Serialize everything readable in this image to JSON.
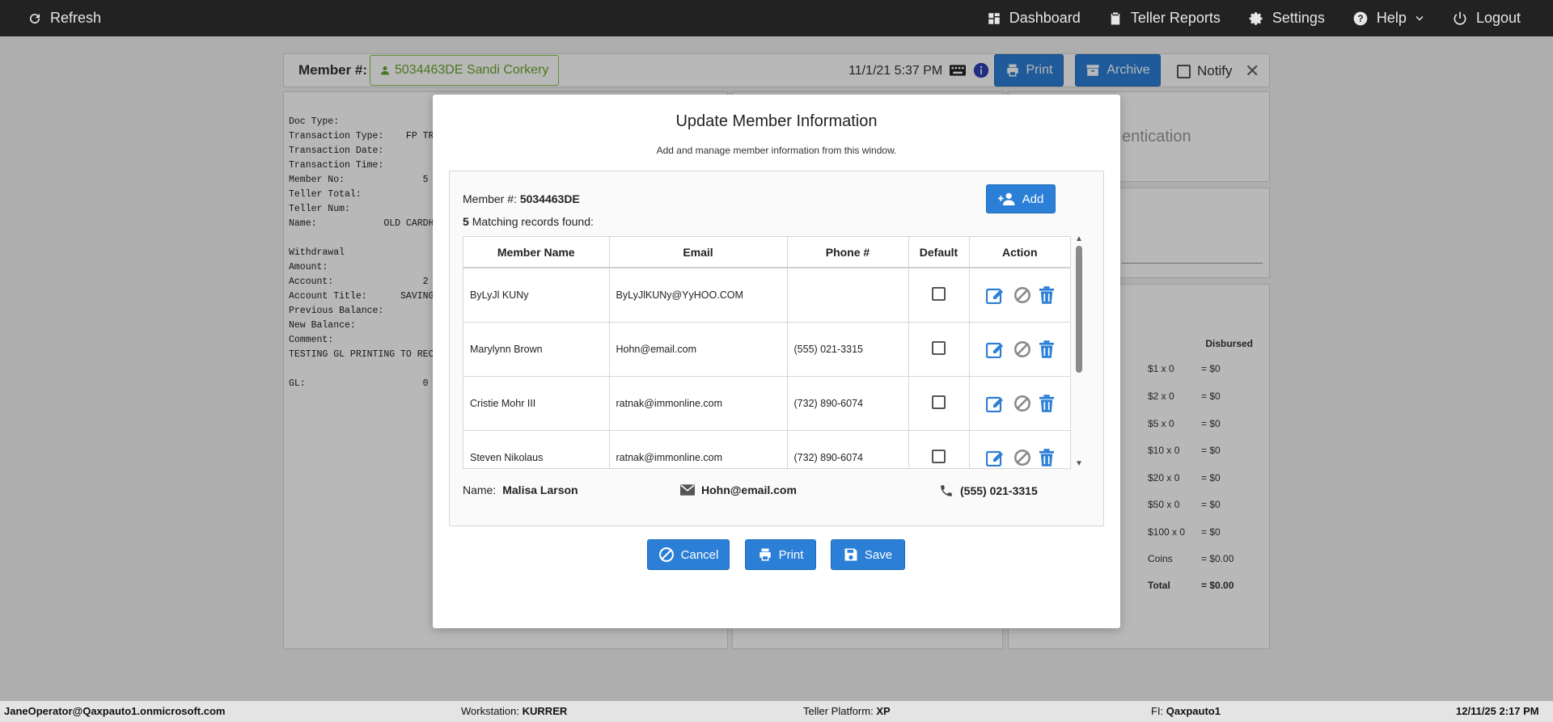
{
  "topbar": {
    "refresh": "Refresh",
    "dashboard": "Dashboard",
    "teller_reports": "Teller Reports",
    "settings": "Settings",
    "help": "Help",
    "logout": "Logout"
  },
  "member_bar": {
    "label": "Member #:",
    "member_badge": "5034463DE Sandi Corkery",
    "datetime": "11/1/21 5:37 PM",
    "print": "Print",
    "archive": "Archive",
    "notify": "Notify"
  },
  "receipt": {
    "lines": "Doc Type:\nTransaction Type:    FP TRA\nTransaction Date:\nTransaction Time:\nMember No:              5\nTeller Total:\nTeller Num:\nName:            OLD CARDH\n\nWithdrawal\nAmount:\nAccount:                2\nAccount Title:      SAVINGS\nPrevious Balance:\nNew Balance:\nComment:\nTESTING GL PRINTING TO RECE\n\nGL:                     0"
  },
  "auth_panel": {
    "text": "entication"
  },
  "cash": {
    "header": "Disbursed",
    "rows": [
      {
        "label": "$1 x 0",
        "value": "= $0"
      },
      {
        "label": "$2 x 0",
        "value": "= $0"
      },
      {
        "label": "$5 x 0",
        "value": "= $0"
      },
      {
        "label": "$10 x 0",
        "value": "= $0"
      },
      {
        "label": "$20 x 0",
        "value": "= $0"
      },
      {
        "label": "$50 x 0",
        "value": "= $0"
      },
      {
        "label": "$100 x 0",
        "value": "= $0"
      },
      {
        "label": "Coins",
        "value": "= $0.00"
      },
      {
        "label": "Total",
        "value": "= $0.00"
      }
    ]
  },
  "modal": {
    "title": "Update Member Information",
    "subtitle": "Add and manage member information from this window.",
    "member_label": "Member #:",
    "member_value": "5034463DE",
    "count_value": "5",
    "count_text": "Matching records found:",
    "add_label": "Add",
    "columns": [
      "Member Name",
      "Email",
      "Phone #",
      "Default",
      "Action"
    ],
    "rows": [
      {
        "name": "ByLyJl KUNy",
        "email": "ByLyJlKUNy@YyHOO.COM",
        "phone": ""
      },
      {
        "name": "Marylynn Brown",
        "email": "Hohn@email.com",
        "phone": "(555) 021-3315"
      },
      {
        "name": "Cristie Mohr III",
        "email": "ratnak@immonline.com",
        "phone": "(732) 890-6074"
      },
      {
        "name": "Steven Nikolaus",
        "email": "ratnak@immonline.com",
        "phone": "(732) 890-6074"
      }
    ],
    "name_label": "Name:",
    "name_value": "Malisa Larson",
    "email_value": "Hohn@email.com",
    "phone_value": "(555) 021-3315",
    "cancel_label": "Cancel",
    "print_label": "Print",
    "save_label": "Save"
  },
  "statusbar": {
    "user": "JaneOperator@Qaxpauto1.onmicrosoft.com",
    "workstation_label": "Workstation:",
    "workstation_value": "KURRER",
    "platform_label": "Teller Platform:",
    "platform_value": "XP",
    "fi_label": "FI:",
    "fi_value": "Qaxpauto1",
    "datetime": "12/11/25 2:17 PM"
  },
  "colors": {
    "topbar": "#222222",
    "accent": "#2b7fd6",
    "member_badge": "#6aa62a"
  }
}
